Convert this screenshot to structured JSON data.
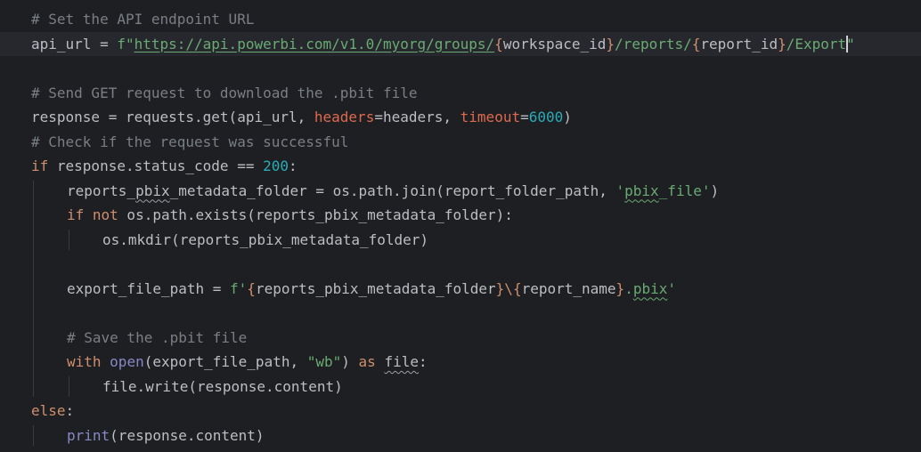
{
  "editor": {
    "language": "python",
    "lines": [
      {
        "tokens": [
          {
            "t": "# Set the API endpoint URL",
            "c": "cmt"
          }
        ]
      },
      {
        "current": true,
        "tokens": [
          {
            "t": "api_url = "
          },
          {
            "t": "f\"",
            "c": "str"
          },
          {
            "t": "https://api.powerbi.com/v1.0/myorg/groups/",
            "c": "str url"
          },
          {
            "t": "{",
            "c": "fb"
          },
          {
            "t": "workspace_id"
          },
          {
            "t": "}",
            "c": "fb"
          },
          {
            "t": "/reports/",
            "c": "str"
          },
          {
            "t": "{",
            "c": "fb"
          },
          {
            "t": "report_id"
          },
          {
            "t": "}",
            "c": "fb"
          },
          {
            "t": "/Export",
            "c": "str"
          },
          {
            "t": "\"",
            "c": "str",
            "caret": true
          }
        ]
      },
      {
        "tokens": []
      },
      {
        "tokens": [
          {
            "t": "# Send GET request to download the .pbit file",
            "c": "cmt"
          }
        ]
      },
      {
        "tokens": [
          {
            "t": "response = requests.get(api_url, "
          },
          {
            "t": "headers",
            "c": "param"
          },
          {
            "t": "=headers, "
          },
          {
            "t": "timeout",
            "c": "param"
          },
          {
            "t": "="
          },
          {
            "t": "6000",
            "c": "num"
          },
          {
            "t": ")"
          }
        ]
      },
      {
        "tokens": [
          {
            "t": "# Check if the request was successful",
            "c": "cmt"
          }
        ]
      },
      {
        "tokens": [
          {
            "t": "if",
            "c": "kw"
          },
          {
            "t": " response.status_code == "
          },
          {
            "t": "200",
            "c": "num"
          },
          {
            "t": ":"
          }
        ]
      },
      {
        "indent": 1,
        "tokens": [
          {
            "t": "reports_"
          },
          {
            "t": "pbix",
            "c": "typo-d"
          },
          {
            "t": "_metadata_folder = os.path.join(report_folder_path, "
          },
          {
            "t": "'",
            "c": "str"
          },
          {
            "t": "pbix",
            "c": "str typo"
          },
          {
            "t": "_file'",
            "c": "str"
          },
          {
            "t": ")"
          }
        ]
      },
      {
        "indent": 1,
        "tokens": [
          {
            "t": "if not",
            "c": "kw"
          },
          {
            "t": " os.path.exists(reports_pbix_metadata_folder):"
          }
        ]
      },
      {
        "indent": 2,
        "tokens": [
          {
            "t": "os.mkdir(reports_pbix_metadata_folder)"
          }
        ]
      },
      {
        "tokens": []
      },
      {
        "indent": 1,
        "tokens": [
          {
            "t": "export_file_path = "
          },
          {
            "t": "f'",
            "c": "str"
          },
          {
            "t": "{",
            "c": "fb"
          },
          {
            "t": "reports_pbix_metadata_folder"
          },
          {
            "t": "}",
            "c": "fb"
          },
          {
            "t": "\\",
            "c": "kw"
          },
          {
            "t": "{",
            "c": "fb"
          },
          {
            "t": "report_name"
          },
          {
            "t": "}",
            "c": "fb"
          },
          {
            "t": ".",
            "c": "str"
          },
          {
            "t": "pbix",
            "c": "str typo"
          },
          {
            "t": "'",
            "c": "str"
          }
        ]
      },
      {
        "tokens": []
      },
      {
        "indent": 1,
        "tokens": [
          {
            "t": "# Save the .pbit file",
            "c": "cmt"
          }
        ]
      },
      {
        "indent": 1,
        "tokens": [
          {
            "t": "with",
            "c": "kw"
          },
          {
            "t": " "
          },
          {
            "t": "open",
            "c": "bi"
          },
          {
            "t": "(export_file_path, "
          },
          {
            "t": "\"wb\"",
            "c": "str"
          },
          {
            "t": ") "
          },
          {
            "t": "as",
            "c": "kw"
          },
          {
            "t": " "
          },
          {
            "t": "file",
            "c": "typo-d"
          },
          {
            "t": ":"
          }
        ]
      },
      {
        "indent": 2,
        "tokens": [
          {
            "t": "file.write(response.content)"
          }
        ]
      },
      {
        "tokens": [
          {
            "t": "else",
            "c": "kw"
          },
          {
            "t": ":"
          }
        ]
      },
      {
        "indent": 1,
        "tokens": [
          {
            "t": "print",
            "c": "bi"
          },
          {
            "t": "(response.content)"
          }
        ]
      }
    ]
  }
}
